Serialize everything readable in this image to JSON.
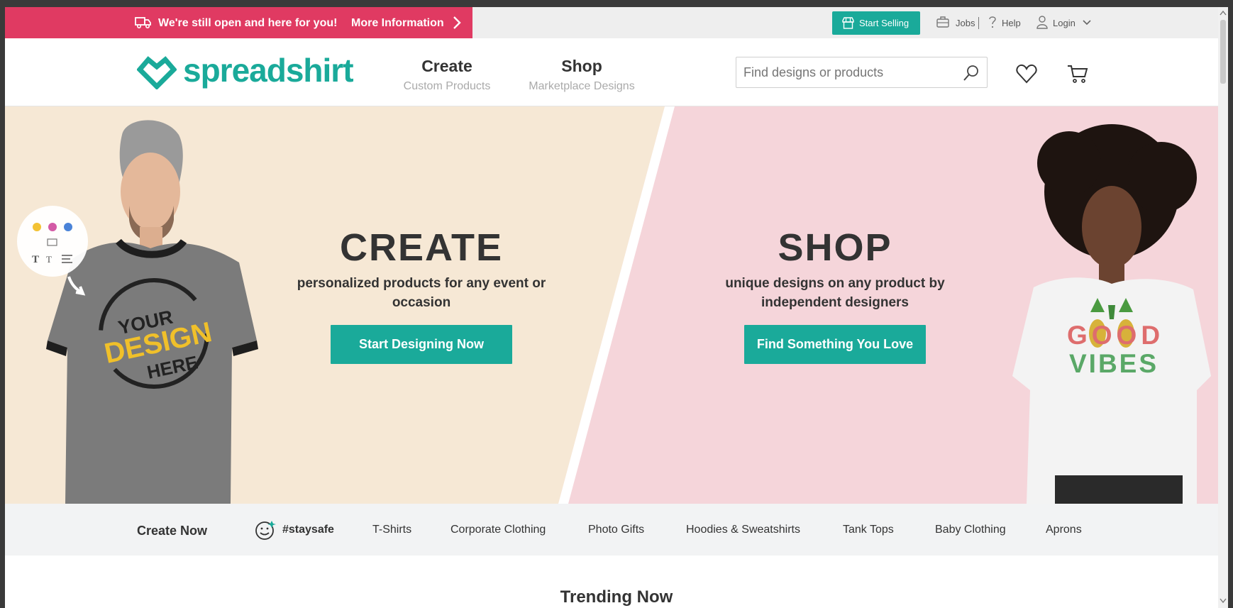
{
  "promo": {
    "message": "We're still open and here for you!",
    "more_label": "More Information"
  },
  "utility": {
    "start_selling": "Start Selling",
    "jobs": "Jobs",
    "help": "Help",
    "login": "Login"
  },
  "header": {
    "logo_text": "spreadshirt",
    "nav": [
      {
        "title": "Create",
        "subtitle": "Custom Products"
      },
      {
        "title": "Shop",
        "subtitle": "Marketplace Designs"
      }
    ],
    "search_placeholder": "Find designs or products"
  },
  "hero": {
    "create": {
      "title": "CREATE",
      "subtitle": "personalized products for any event or occasion",
      "button": "Start Designing Now"
    },
    "shop": {
      "title": "SHOP",
      "subtitle": "unique designs on any product by independent designers",
      "button": "Find Something You Love"
    },
    "shirt_left_text": [
      "YOUR",
      "DESIGN",
      "HERE"
    ],
    "shirt_right_text": [
      "GOOD",
      "VIBES"
    ]
  },
  "categories": {
    "create_now": "Create Now",
    "items": [
      "#staysafe",
      "T-Shirts",
      "Corporate Clothing",
      "Photo Gifts",
      "Hoodies & Sweatshirts",
      "Tank Tops",
      "Baby Clothing",
      "Aprons"
    ]
  },
  "trending_title": "Trending Now",
  "colors": {
    "brand": "#1aaa9a",
    "promo": "#e03a62",
    "create_bg": "#f6e8d5",
    "shop_bg": "#f5d5da"
  }
}
